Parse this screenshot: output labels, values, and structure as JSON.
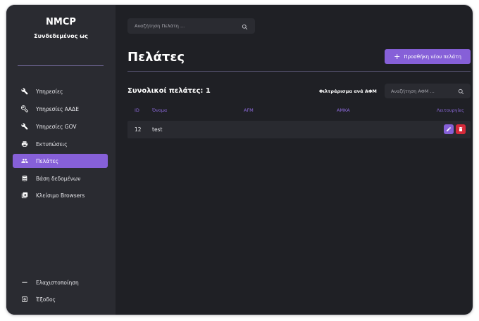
{
  "sidebar": {
    "brand": "NMCP",
    "subtitle": "Συνδεδεμένος ως",
    "items": [
      {
        "label": "Υπηρεσίες",
        "icon": "wrench-icon"
      },
      {
        "label": "Υπηρεσίες ΑΑΔΕ",
        "icon": "tools-icon"
      },
      {
        "label": "Υπηρεσίες GOV",
        "icon": "wrench-icon"
      },
      {
        "label": "Εκτυπώσεις",
        "icon": "printer-icon"
      },
      {
        "label": "Πελάτες",
        "icon": "users-icon",
        "active": true
      },
      {
        "label": "Βάση δεδομένων",
        "icon": "database-icon"
      },
      {
        "label": "Κλείσιμο Browsers",
        "icon": "close-windows-icon"
      }
    ],
    "bottom_items": [
      {
        "label": "Ελαχιστοποίηση",
        "icon": "minimize-icon"
      },
      {
        "label": "Έξοδος",
        "icon": "logout-icon"
      }
    ]
  },
  "header": {
    "search_placeholder": "Αναζήτηση Πελάτη ...",
    "search_icon": "search-icon"
  },
  "main": {
    "title": "Πελάτες",
    "add_button_label": "Προσθήκη νέου πελάτη",
    "total_label": "Συνολικοί πελάτες: 1",
    "filter_label": "Φιλτράρισμα ανά ΑΦΜ",
    "afm_search_placeholder": "Αναζήτηση ΑΦΜ ..."
  },
  "table": {
    "columns": [
      "ID",
      "Όνομα",
      "AFM",
      "AMKA",
      "Λειτουργίες"
    ],
    "rows": [
      {
        "id": "12",
        "name": "test",
        "afm": "",
        "amka": ""
      }
    ]
  },
  "colors": {
    "accent": "#8660d8",
    "danger": "#d62a3a",
    "background": "#1f2025",
    "sidebar": "#2a2b31"
  }
}
